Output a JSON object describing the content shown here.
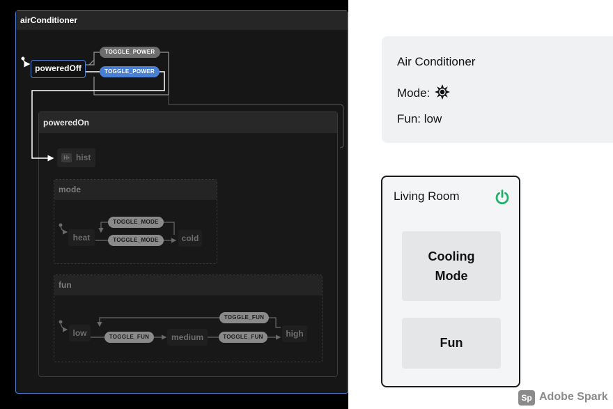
{
  "statechart": {
    "machine_title": "airConditioner",
    "powered_off": "poweredOff",
    "powered_on": "poweredOn",
    "history": {
      "badge": "H•",
      "label": "hist"
    },
    "mode_region": {
      "title": "mode",
      "heat": "heat",
      "cold": "cold",
      "toggle_top": "TOGGLE_MODE",
      "toggle_bottom": "TOGGLE_MODE"
    },
    "fun_region": {
      "title": "fun",
      "low": "low",
      "medium": "medium",
      "high": "high",
      "toggle_back": "TOGGLE_FUN",
      "toggle_low_medium": "TOGGLE_FUN",
      "toggle_medium_high": "TOGGLE_FUN"
    },
    "power_transitions": {
      "self": "TOGGLE_POWER",
      "to_on": "TOGGLE_POWER"
    }
  },
  "info_card": {
    "title": "Air Conditioner",
    "mode_label": "Mode:",
    "mode_icon": "sun-icon",
    "fun_text": "Fun: low"
  },
  "room_card": {
    "title": "Living Room",
    "power_icon": "power-icon",
    "power_color": "#22b06b",
    "cooling_button": "Cooling Mode",
    "fun_button": "Fun"
  },
  "brand": {
    "badge": "Sp",
    "name": "Adobe Spark"
  }
}
